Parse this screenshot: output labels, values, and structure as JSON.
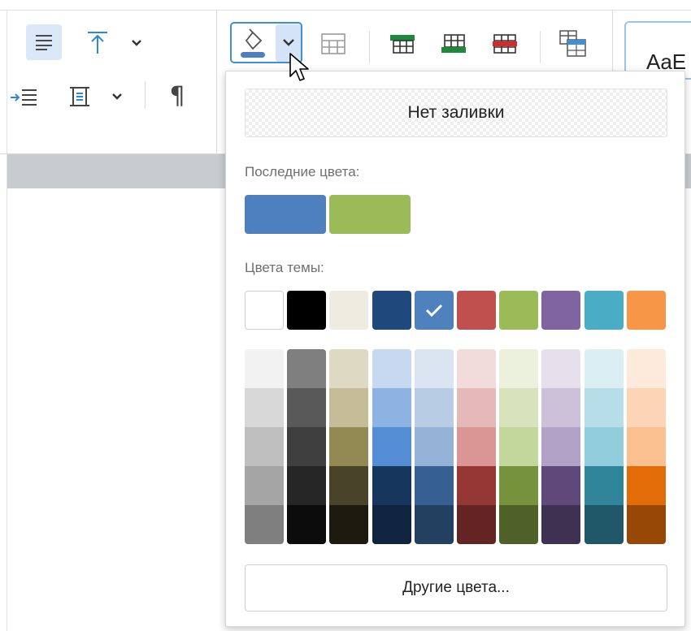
{
  "ribbon": {
    "paragraph_mark": "¶",
    "style_preview": "AaE"
  },
  "popup": {
    "no_fill_label": "Нет заливки",
    "recent_label": "Последние цвета:",
    "recent_colors": [
      "#4e80bf",
      "#9bbb59"
    ],
    "theme_label": "Цвета темы:",
    "theme_colors": [
      "#ffffff",
      "#000000",
      "#eeece1",
      "#1f497d",
      "#4f81bd",
      "#c0504d",
      "#9bbb59",
      "#8064a2",
      "#4bacc6",
      "#f79646"
    ],
    "selected_theme_index": 4,
    "shade_columns": [
      [
        "#f2f2f2",
        "#d8d8d8",
        "#bfbfbf",
        "#a5a5a5",
        "#7f7f7f"
      ],
      [
        "#7f7f7f",
        "#595959",
        "#3f3f3f",
        "#262626",
        "#0c0c0c"
      ],
      [
        "#ddd9c3",
        "#c4bd97",
        "#938953",
        "#494429",
        "#1d1b10"
      ],
      [
        "#c6d9f0",
        "#8db3e2",
        "#548dd4",
        "#17365d",
        "#0f243e"
      ],
      [
        "#dbe5f1",
        "#b8cce4",
        "#95b3d7",
        "#366092",
        "#244061"
      ],
      [
        "#f2dcdb",
        "#e5b9b7",
        "#d99694",
        "#953734",
        "#632423"
      ],
      [
        "#ebf1dd",
        "#d7e3bc",
        "#c3d69b",
        "#76923c",
        "#4f6128"
      ],
      [
        "#e5e0ec",
        "#ccc1d9",
        "#b2a2c7",
        "#5f497a",
        "#3f3151"
      ],
      [
        "#dbeef3",
        "#b7dde8",
        "#92cddc",
        "#31859b",
        "#205867"
      ],
      [
        "#fdeada",
        "#fbd5b5",
        "#fac08f",
        "#e36c09",
        "#974806"
      ]
    ],
    "more_colors_label": "Другие цвета..."
  },
  "colors": {
    "accent": "#3d8fd6",
    "fill_indicator": "#4e80bf"
  }
}
